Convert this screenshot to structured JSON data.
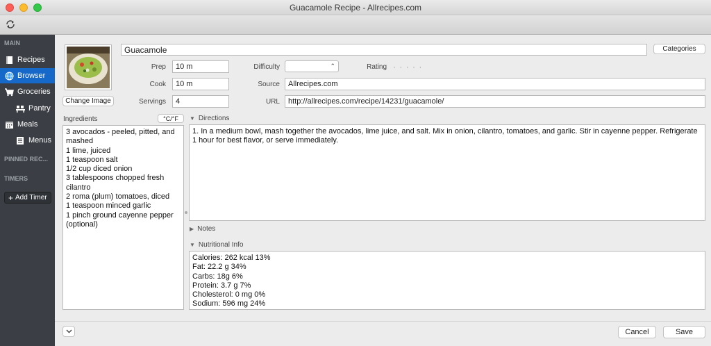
{
  "window": {
    "title": "Guacamole Recipe - Allrecipes.com"
  },
  "toolbar": {
    "sync_icon": "sync-icon"
  },
  "sidebar": {
    "main_header": "MAIN",
    "items": [
      {
        "label": "Recipes",
        "icon": "book-icon"
      },
      {
        "label": "Browser",
        "icon": "globe-icon",
        "active": true
      },
      {
        "label": "Groceries",
        "icon": "cart-icon"
      },
      {
        "label": "Pantry",
        "icon": "shelf-icon"
      },
      {
        "label": "Meals",
        "icon": "calendar-icon"
      },
      {
        "label": "Menus",
        "icon": "list-icon"
      }
    ],
    "pinned_header": "PINNED REC...",
    "timers_header": "TIMERS",
    "add_timer_label": "Add Timer"
  },
  "recipe": {
    "name": "Guacamole",
    "categories_label": "Categories",
    "change_image_label": "Change Image",
    "prep_label": "Prep",
    "prep": "10 m",
    "cook_label": "Cook",
    "cook": "10 m",
    "servings_label": "Servings",
    "servings": "4",
    "difficulty_label": "Difficulty",
    "difficulty": "",
    "rating_label": "Rating",
    "rating_dots": "· · · · ·",
    "source_label": "Source",
    "source": "Allrecipes.com",
    "url_label": "URL",
    "url": "http://allrecipes.com/recipe/14231/guacamole/"
  },
  "ingredients": {
    "label": "Ingredients",
    "unit_toggle": "°C/°F",
    "text": "3 avocados - peeled, pitted, and mashed\n1 lime, juiced\n1 teaspoon salt\n1/2 cup diced onion\n3 tablespoons chopped fresh cilantro\n2 roma (plum) tomatoes, diced\n1 teaspoon minced garlic\n1 pinch ground cayenne pepper (optional)"
  },
  "directions": {
    "label": "Directions",
    "text": "1. In a medium bowl, mash together the avocados, lime juice, and salt. Mix in onion, cilantro, tomatoes, and garlic. Stir in cayenne pepper. Refrigerate 1 hour for best flavor, or serve immediately."
  },
  "notes": {
    "label": "Notes"
  },
  "nutrition": {
    "label": "Nutritional Info",
    "text": "Calories: 262 kcal 13%\nFat: 22.2 g 34%\nCarbs: 18g 6%\nProtein: 3.7 g 7%\nCholesterol: 0 mg 0%\nSodium: 596 mg 24%"
  },
  "footer": {
    "cancel_label": "Cancel",
    "save_label": "Save"
  }
}
